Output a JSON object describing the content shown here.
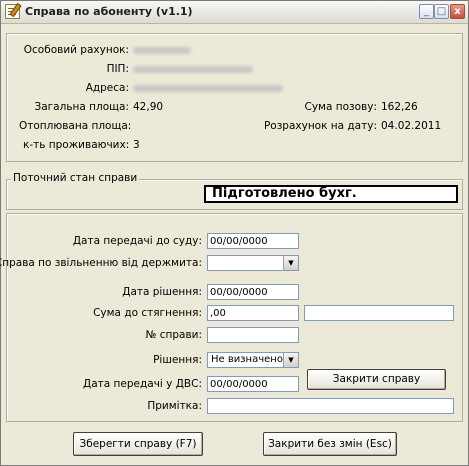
{
  "window": {
    "title": "Справа по абоненту (v1.1)",
    "controls": {
      "minimize": "_",
      "maximize": "□",
      "close": "x"
    }
  },
  "info": {
    "account_label": "Особовий рахунок:",
    "name_label": "ПІП:",
    "address_label": "Адреса:",
    "total_area_label": "Загальна площа:",
    "total_area_value": "42,90",
    "heated_area_label": "Отоплювана площа:",
    "residents_label": "к-ть проживаючих:",
    "residents_value": "3",
    "claim_sum_label": "Сума позову:",
    "claim_sum_value": "162,26",
    "calc_date_label": "Розрахунок на дату:",
    "calc_date_value": "04.02.2011"
  },
  "status": {
    "group_label": "Поточний стан справи",
    "value": "Підготовлено бухг."
  },
  "form": {
    "court_date_label": "Дата передачі до суду:",
    "court_date_value": "00/00/0000",
    "duty_exempt_label": "Справа по звільненню від держмита:",
    "duty_exempt_value": "",
    "decision_date_label": "Дата рішення:",
    "decision_date_value": "00/00/0000",
    "recovery_sum_label": "Сума до стягнення:",
    "recovery_sum_value": ",00",
    "recovery_extra_value": "",
    "case_number_label": "№ справи:",
    "case_number_value": "",
    "decision_label": "Рішення:",
    "decision_value": "Не визначено",
    "dvs_date_label": "Дата передачі у ДВС:",
    "dvs_date_value": "00/00/0000",
    "note_label": "Примітка:",
    "note_value": "",
    "close_case_button": "Закрити справу"
  },
  "footer": {
    "save_button": "Зберегти справу (F7)",
    "close_button": "Закрити без змін (Esc)"
  }
}
